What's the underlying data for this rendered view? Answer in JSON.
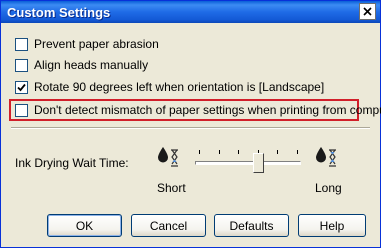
{
  "window": {
    "title": "Custom Settings"
  },
  "options": [
    {
      "label": "Prevent paper abrasion",
      "checked": false
    },
    {
      "label": "Align heads manually",
      "checked": false
    },
    {
      "label": "Rotate 90 degrees left when orientation is [Landscape]",
      "checked": true
    },
    {
      "label": "Don't detect mismatch of paper settings when printing from computer",
      "checked": false
    }
  ],
  "ink_drying": {
    "label": "Ink Drying Wait Time:",
    "min_label": "Short",
    "max_label": "Long",
    "position": 3,
    "positions": 6
  },
  "buttons": {
    "ok": "OK",
    "cancel": "Cancel",
    "defaults": "Defaults",
    "help": "Help"
  },
  "colors": {
    "highlight": "#d11f2a",
    "titlebar": "#1f6be6"
  }
}
